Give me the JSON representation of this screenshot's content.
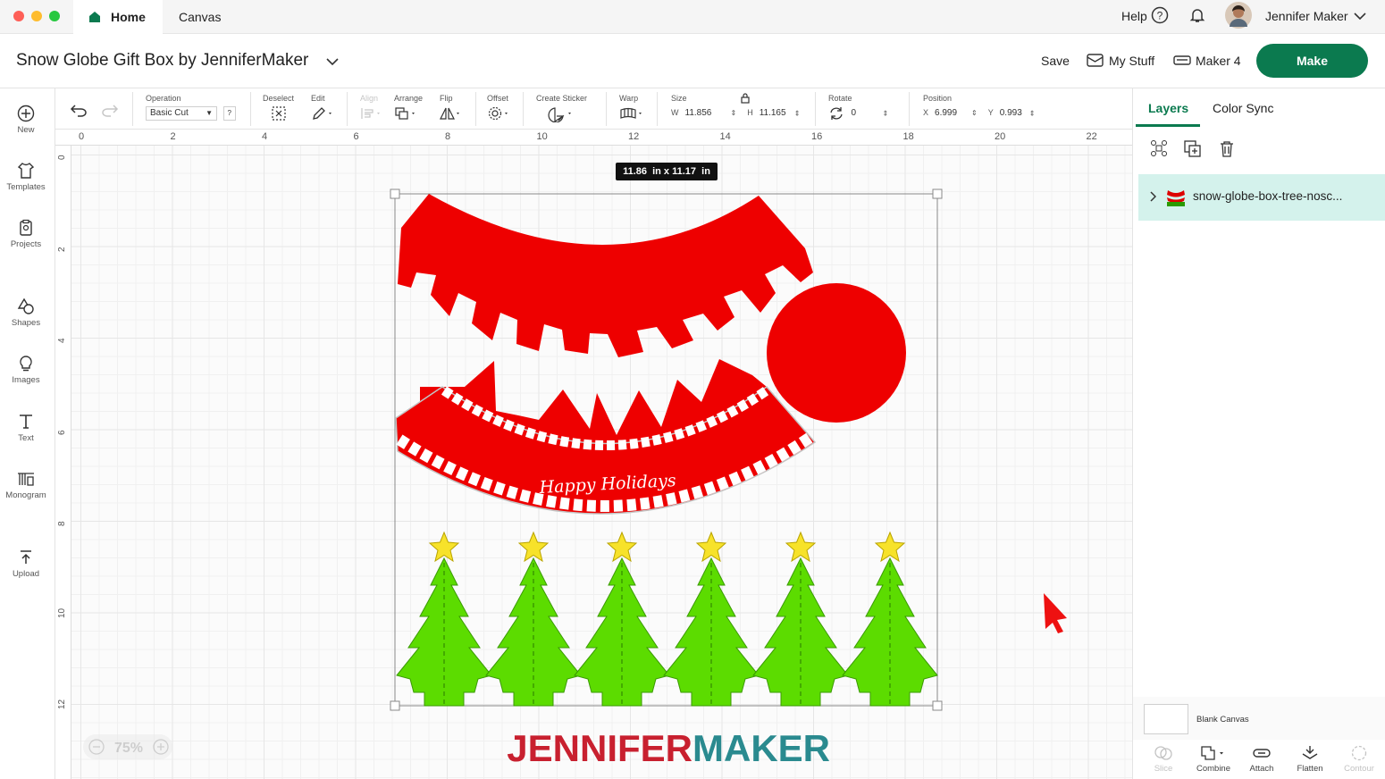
{
  "tabs": {
    "home": "Home",
    "canvas": "Canvas"
  },
  "header": {
    "help": "Help",
    "user_name": "Jennifer Maker",
    "project_title": "Snow Globe Gift Box by JenniferMaker",
    "save": "Save",
    "my_stuff": "My Stuff",
    "machine": "Maker 4",
    "make": "Make"
  },
  "toolbar": {
    "operation_label": "Operation",
    "operation_value": "Basic Cut",
    "help_q": "?",
    "deselect": "Deselect",
    "edit": "Edit",
    "align": "Align",
    "arrange": "Arrange",
    "flip": "Flip",
    "offset": "Offset",
    "create_sticker": "Create Sticker",
    "warp": "Warp",
    "size": "Size",
    "w_label": "W",
    "w_value": "11.856",
    "h_label": "H",
    "h_value": "11.165",
    "rotate": "Rotate",
    "rotate_value": "0",
    "position": "Position",
    "x_label": "X",
    "x_value": "6.999",
    "y_label": "Y",
    "y_value": "0.993"
  },
  "left_nav": {
    "new": "New",
    "templates": "Templates",
    "projects": "Projects",
    "shapes": "Shapes",
    "images": "Images",
    "text": "Text",
    "monogram": "Monogram",
    "upload": "Upload"
  },
  "ruler": {
    "top": [
      "0",
      "2",
      "4",
      "6",
      "8",
      "10",
      "12",
      "14",
      "16",
      "18",
      "20",
      "22"
    ],
    "left": [
      "0",
      "2",
      "4",
      "6",
      "8",
      "10",
      "12"
    ]
  },
  "canvas": {
    "size_badge": "11.86  in x 11.17  in",
    "banner_text": "Happy Holidays",
    "zoom": "75%",
    "brand_a": "JENNIFER",
    "brand_b": "MAKER"
  },
  "right_panel": {
    "tab_layers": "Layers",
    "tab_color_sync": "Color Sync",
    "layer_name": "snow-globe-box-tree-nosc...",
    "blank_canvas": "Blank Canvas",
    "slice": "Slice",
    "combine": "Combine",
    "attach": "Attach",
    "flatten": "Flatten",
    "contour": "Contour"
  },
  "colors": {
    "accent": "#0b7a4f",
    "red": "#ee0000",
    "green": "#5cdc00",
    "star": "#f7e22a",
    "layer_bg": "#d4f2ec",
    "brand_red": "#c8202f",
    "brand_teal": "#2a8a8f"
  }
}
